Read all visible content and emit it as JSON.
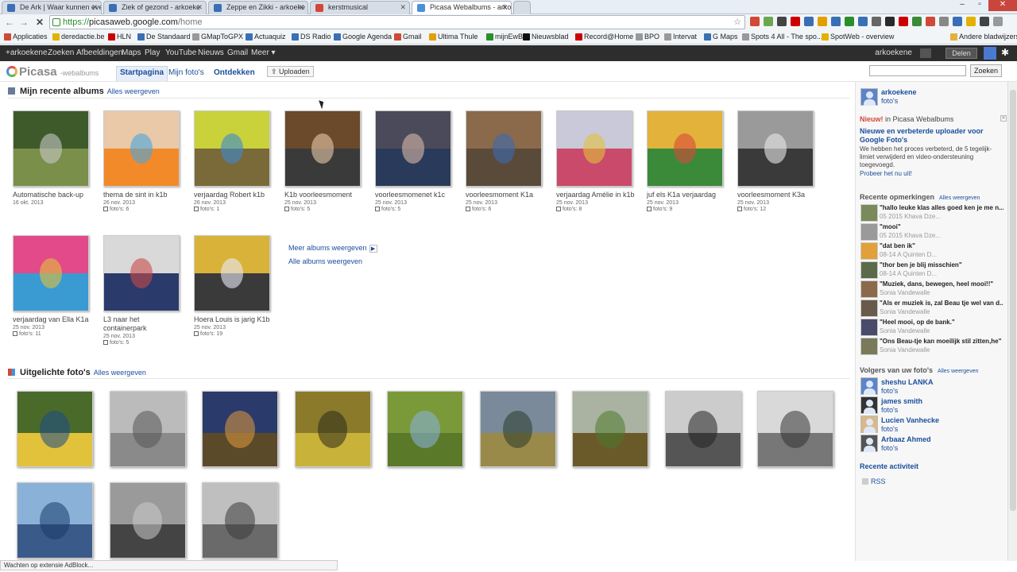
{
  "browser": {
    "tabs": [
      {
        "label": "De Ark | Waar kunnen eve",
        "favicon": "#3a6fb5"
      },
      {
        "label": "Ziek of gezond - arkoeke",
        "favicon": "#3a6fb5"
      },
      {
        "label": "Zeppe en Zikki - arkoeke",
        "favicon": "#3a6fb5"
      },
      {
        "label": "kerstmusical",
        "favicon": "#d14836"
      },
      {
        "label": "Picasa Webalbums - arko",
        "favicon": "#4a90d9"
      }
    ],
    "url_scheme": "https://",
    "url_host": "picasaweb.google.com",
    "url_path": "/home",
    "bookmarks": [
      {
        "label": "Applicaties",
        "color": "#d14836"
      },
      {
        "label": "deredactie.be",
        "color": "#e2b200"
      },
      {
        "label": "HLN",
        "color": "#c00"
      },
      {
        "label": "De Standaard",
        "color": "#3a6fb5"
      },
      {
        "label": "GMapToGPX",
        "color": "#999"
      },
      {
        "label": "Actuaquiz",
        "color": "#3a6fb5"
      },
      {
        "label": "DS Radio",
        "color": "#3a6fb5"
      },
      {
        "label": "Google Agenda",
        "color": "#3a6fb5"
      },
      {
        "label": "Gmail",
        "color": "#d14836"
      },
      {
        "label": "Ultima Thule",
        "color": "#e2a000"
      },
      {
        "label": "mijnEwB",
        "color": "#2a8f2a"
      },
      {
        "label": "Nieuwsblad",
        "color": "#111"
      },
      {
        "label": "Record@Home",
        "color": "#c00"
      },
      {
        "label": "BPO",
        "color": "#999"
      },
      {
        "label": "Intervat",
        "color": "#999"
      },
      {
        "label": "G Maps",
        "color": "#3a6fb5"
      },
      {
        "label": "Spots 4 All - The spo...",
        "color": "#999"
      },
      {
        "label": "SpotWeb - overview",
        "color": "#e2b200"
      }
    ],
    "other_bookmarks": "Andere bladwijzers",
    "status": "Wachten op extensie AdBlock..."
  },
  "gbar": {
    "items": [
      "+arkoekene",
      "Zoeken",
      "Afbeeldingen",
      "Maps",
      "Play",
      "YouTube",
      "Nieuws",
      "Gmail",
      "Meer ▾"
    ],
    "user": "arkoekene",
    "share": "Delen"
  },
  "picasa": {
    "logo": "Picasa",
    "logo_sub": "-webalbums",
    "tabs": [
      "Startpagina",
      "Mijn foto's",
      "Ontdekken"
    ],
    "upload": "Uploaden",
    "search_button": "Zoeken"
  },
  "recent": {
    "title": "Mijn recente albums",
    "link": "Alles weergeven",
    "albums": [
      {
        "title": "Automatische back-up",
        "date": "16 okt. 2013",
        "count": "",
        "colors": [
          "#3e5a2a",
          "#7a8f4a",
          "#c8c8c8"
        ]
      },
      {
        "title": "thema de sint in k1b",
        "date": "26 nov. 2013",
        "count": "foto's: 6",
        "colors": [
          "#e9c9a8",
          "#f28a2a",
          "#48a6e0"
        ]
      },
      {
        "title": "verjaardag Robert k1b",
        "date": "26 nov. 2013",
        "count": "foto's: 1",
        "colors": [
          "#c9d23a",
          "#7a6a3a",
          "#3a8ad2"
        ]
      },
      {
        "title": "K1b voorleesmoment",
        "date": "25 nov. 2013",
        "count": "foto's: 5",
        "colors": [
          "#6a4a2a",
          "#3a3a3a",
          "#e9c9a8"
        ]
      },
      {
        "title": "voorleesmomenet k1c",
        "date": "25 nov. 2013",
        "count": "foto's: 5",
        "colors": [
          "#4a4a5a",
          "#2a3a5a",
          "#d9b9a8"
        ]
      },
      {
        "title": "voorleesmoment K1a",
        "date": "25 nov. 2013",
        "count": "foto's: 6",
        "colors": [
          "#8a6a4a",
          "#5a4a3a",
          "#3a6ab2"
        ]
      },
      {
        "title": "verjaardag Amélie in k1b",
        "date": "25 nov. 2013",
        "count": "foto's: 8",
        "colors": [
          "#c9c9d9",
          "#c94a6a",
          "#e2c23a"
        ]
      },
      {
        "title": "juf els K1a verjaardag",
        "date": "25 nov. 2013",
        "count": "foto's: 9",
        "colors": [
          "#e2b23a",
          "#3a8a3a",
          "#d94a3a"
        ]
      },
      {
        "title": "voorleesmoment K3a",
        "date": "25 nov. 2013",
        "count": "foto's: 12",
        "colors": [
          "#9a9a9a",
          "#3a3a3a",
          "#e9e9e9"
        ]
      },
      {
        "title": "verjaardag van Ella K1a",
        "date": "25 nov. 2013",
        "count": "foto's: 11",
        "colors": [
          "#e24a8a",
          "#3a9ad2",
          "#e2c23a"
        ]
      },
      {
        "title": "L3 naar het containerpark",
        "date": "25 nov. 2013",
        "count": "foto's: 5",
        "colors": [
          "#d9d9d9",
          "#2a3a6a",
          "#c94a4a"
        ]
      },
      {
        "title": "Hoera Louis is jarig K1b",
        "date": "25 nov. 2013",
        "count": "foto's: 19",
        "colors": [
          "#d9b23a",
          "#3a3a3a",
          "#e9e9f9"
        ]
      }
    ],
    "more": "Meer albums weergeven",
    "all": "Alle albums weergeven"
  },
  "featured": {
    "title": "Uitgelichte foto's",
    "link": "Alles weergeven",
    "photos": [
      {
        "name": "peacock",
        "colors": [
          "#4a6a2a",
          "#e2c23a",
          "#1a4a8a"
        ]
      },
      {
        "name": "misty-trees",
        "colors": [
          "#bbbbbb",
          "#8a8a8a",
          "#555555"
        ]
      },
      {
        "name": "canal-night",
        "colors": [
          "#2a3a6a",
          "#5a4a2a",
          "#e29a3a"
        ]
      },
      {
        "name": "yellow-figure",
        "colors": [
          "#8a7a2a",
          "#c9b23a",
          "#2a2a1a"
        ]
      },
      {
        "name": "butterfly",
        "colors": [
          "#7a9a3a",
          "#5a7a2a",
          "#8ab2e2"
        ]
      },
      {
        "name": "mountain-valley",
        "colors": [
          "#7a8a9a",
          "#9a8a4a",
          "#2a3a2a"
        ]
      },
      {
        "name": "tree-landscape",
        "colors": [
          "#aab2a2",
          "#6a5a2a",
          "#4a7a2a"
        ]
      },
      {
        "name": "bw-portrait",
        "colors": [
          "#cccccc",
          "#555555",
          "#222222"
        ]
      },
      {
        "name": "bw-architecture",
        "colors": [
          "#d9d9d9",
          "#777777",
          "#333333"
        ]
      },
      {
        "name": "blue-car",
        "colors": [
          "#8ab2d9",
          "#3a5a8a",
          "#1a3a6a"
        ]
      },
      {
        "name": "bw-woman",
        "colors": [
          "#9a9a9a",
          "#444444",
          "#cccccc"
        ]
      },
      {
        "name": "foggy-forest",
        "colors": [
          "#bfbfbf",
          "#6a6a6a",
          "#3a3a3a"
        ]
      }
    ]
  },
  "sidebar": {
    "user_name": "arkoekene",
    "user_link": "foto's",
    "new_label": "Nieuw!",
    "new_in": " in Picasa Webalbums",
    "new_title": "Nieuwe en verbeterde uploader voor Google Foto's",
    "new_text": "We hebben het proces verbeterd, de 5 tegelijk-limiet verwijderd en video-ondersteuning toegevoegd.",
    "new_try": "Probeer het nu uit!",
    "comments_title": "Recente opmerkingen",
    "comments_link": "Alles weergeven",
    "comments": [
      {
        "quote": "\"hallo leuke klas alles goed ken je me n...",
        "who": "05 2015 Khava Dze...",
        "color": "#7a8a5a"
      },
      {
        "quote": "\"mooi\"",
        "who": "05 2015 Khava Dze...",
        "color": "#9a9a9a"
      },
      {
        "quote": "\"dat ben ik\"",
        "who": "08-14 A Quinten D...",
        "color": "#e2a03a"
      },
      {
        "quote": "\"thor ben je blij misschien\"",
        "who": "08-14 A Quinten D...",
        "color": "#5a6a4a"
      },
      {
        "quote": "\"Muziek, dans, bewegen, heel mooi!!\"",
        "who": "Sonia Vandewalle",
        "color": "#8a6a4a"
      },
      {
        "quote": "\"Als er muziek is, zal Beau tje wel van d...",
        "who": "Sonia Vandewalle",
        "color": "#6a5a4a"
      },
      {
        "quote": "\"Heel mooi, op de bank.\"",
        "who": "Sonia Vandewalle",
        "color": "#4a4a6a"
      },
      {
        "quote": "\"Ons Beau-tje kan moeilijk stil zitten,he\"",
        "who": "Sonia Vandewalle",
        "color": "#7a7a5a"
      }
    ],
    "followers_title": "Volgers van uw foto's",
    "followers_link": "Alles weergeven",
    "followers": [
      {
        "name": "sheshu LANKA",
        "link": "foto's"
      },
      {
        "name": "james smith",
        "link": "foto's"
      },
      {
        "name": "Lucien Vanhecke",
        "link": "foto's"
      },
      {
        "name": "Arbaaz Ahmed",
        "link": "foto's"
      }
    ],
    "activity_title": "Recente activiteit",
    "rss": "RSS"
  }
}
